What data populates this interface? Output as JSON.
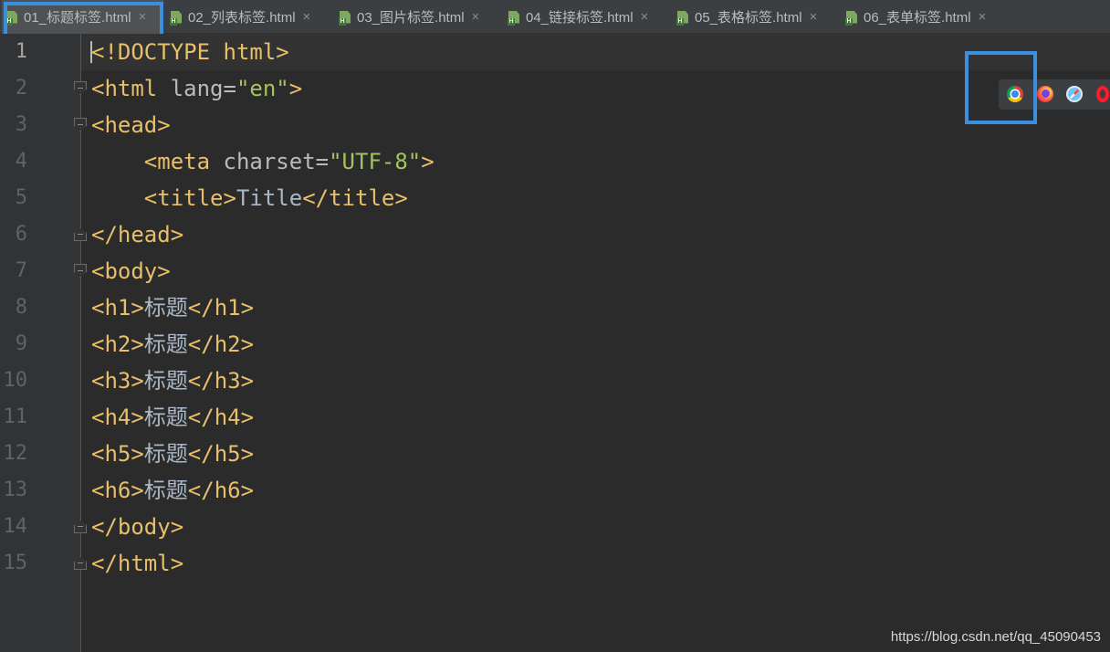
{
  "tabs": [
    {
      "label": "01_标题标签.html",
      "active": true
    },
    {
      "label": "02_列表标签.html",
      "active": false
    },
    {
      "label": "03_图片标签.html",
      "active": false
    },
    {
      "label": "04_链接标签.html",
      "active": false
    },
    {
      "label": "05_表格标签.html",
      "active": false
    },
    {
      "label": "06_表单标签.html",
      "active": false
    }
  ],
  "tab_close_glyph": "×",
  "file_icon_badge": "H",
  "editor": {
    "current_line": 1,
    "line_numbers": [
      "1",
      "2",
      "3",
      "4",
      "5",
      "6",
      "7",
      "8",
      "9",
      "10",
      "11",
      "12",
      "13",
      "14",
      "15"
    ],
    "lines": [
      [
        {
          "t": "tag",
          "v": "<!DOCTYPE html>"
        }
      ],
      [
        {
          "t": "tag",
          "v": "<html "
        },
        {
          "t": "attr",
          "v": "lang="
        },
        {
          "t": "val",
          "v": "\"en\""
        },
        {
          "t": "tag",
          "v": ">"
        }
      ],
      [
        {
          "t": "tag",
          "v": "<head>"
        }
      ],
      [
        {
          "t": "text",
          "v": "    "
        },
        {
          "t": "tag",
          "v": "<meta "
        },
        {
          "t": "attr",
          "v": "charset="
        },
        {
          "t": "val",
          "v": "\"UTF-8\""
        },
        {
          "t": "tag",
          "v": ">"
        }
      ],
      [
        {
          "t": "text",
          "v": "    "
        },
        {
          "t": "tag",
          "v": "<title>"
        },
        {
          "t": "text",
          "v": "Title"
        },
        {
          "t": "tag",
          "v": "</title>"
        }
      ],
      [
        {
          "t": "tag",
          "v": "</head>"
        }
      ],
      [
        {
          "t": "tag",
          "v": "<body>"
        }
      ],
      [
        {
          "t": "tag",
          "v": "<h1>"
        },
        {
          "t": "text",
          "v": "标题"
        },
        {
          "t": "tag",
          "v": "</h1>"
        }
      ],
      [
        {
          "t": "tag",
          "v": "<h2>"
        },
        {
          "t": "text",
          "v": "标题"
        },
        {
          "t": "tag",
          "v": "</h2>"
        }
      ],
      [
        {
          "t": "tag",
          "v": "<h3>"
        },
        {
          "t": "text",
          "v": "标题"
        },
        {
          "t": "tag",
          "v": "</h3>"
        }
      ],
      [
        {
          "t": "tag",
          "v": "<h4>"
        },
        {
          "t": "text",
          "v": "标题"
        },
        {
          "t": "tag",
          "v": "</h4>"
        }
      ],
      [
        {
          "t": "tag",
          "v": "<h5>"
        },
        {
          "t": "text",
          "v": "标题"
        },
        {
          "t": "tag",
          "v": "</h5>"
        }
      ],
      [
        {
          "t": "tag",
          "v": "<h6>"
        },
        {
          "t": "text",
          "v": "标题"
        },
        {
          "t": "tag",
          "v": "</h6>"
        }
      ],
      [
        {
          "t": "tag",
          "v": "</body>"
        }
      ],
      [
        {
          "t": "tag",
          "v": "</html>"
        }
      ]
    ]
  },
  "browser_icons": [
    {
      "name": "chrome-icon"
    },
    {
      "name": "firefox-icon"
    },
    {
      "name": "safari-icon"
    },
    {
      "name": "opera-icon"
    }
  ],
  "watermark": "https://blog.csdn.net/qq_45090453",
  "colors": {
    "background": "#2b2b2b",
    "tag": "#e8bf6a",
    "attribute": "#bababa",
    "value": "#a5c261",
    "text": "#a9b7c6",
    "highlight": "#3b8fdf"
  }
}
